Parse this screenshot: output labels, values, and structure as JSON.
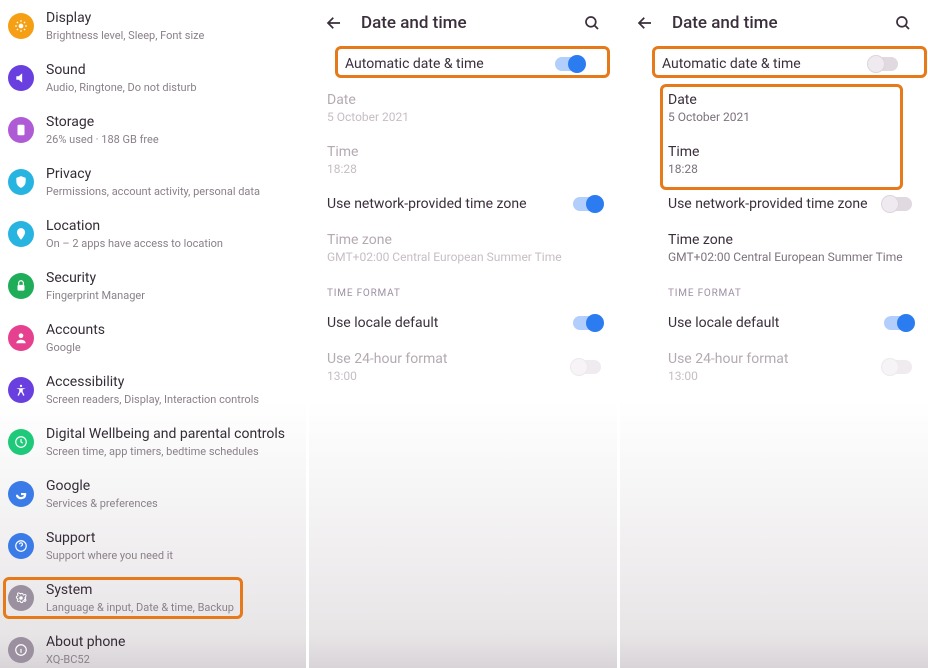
{
  "settings": {
    "items": [
      {
        "title": "Display",
        "sub": "Brightness level, Sleep, Font size",
        "color": "#f5a014"
      },
      {
        "title": "Sound",
        "sub": "Audio, Ringtone, Do not disturb",
        "color": "#6a3fe0"
      },
      {
        "title": "Storage",
        "sub": "26% used · 188 GB free",
        "color": "#b05bd6"
      },
      {
        "title": "Privacy",
        "sub": "Permissions, account activity, personal data",
        "color": "#28b4e0"
      },
      {
        "title": "Location",
        "sub": "On – 2 apps have access to location",
        "color": "#28b4e0"
      },
      {
        "title": "Security",
        "sub": "Fingerprint Manager",
        "color": "#1fad5a"
      },
      {
        "title": "Accounts",
        "sub": "Google",
        "color": "#e6418f"
      },
      {
        "title": "Accessibility",
        "sub": "Screen readers, Display, Interaction controls",
        "color": "#6a3fe0"
      },
      {
        "title": "Digital Wellbeing and parental controls",
        "sub": "Screen time, app timers, bedtime schedules",
        "color": "#1fc97a"
      },
      {
        "title": "Google",
        "sub": "Services & preferences",
        "color": "#3a7be8"
      },
      {
        "title": "Support",
        "sub": "Support where you need it",
        "color": "#3a7be8"
      },
      {
        "title": "System",
        "sub": "Language & input, Date & time, Backup",
        "color": "#9a90a0"
      },
      {
        "title": "About phone",
        "sub": "XQ-BC52",
        "color": "#9a90a0"
      }
    ]
  },
  "dt": {
    "title": "Date and time",
    "auto": "Automatic date & time",
    "date_l": "Date",
    "date_v": "5 October 2021",
    "time_l": "Time",
    "time_v": "18:28",
    "netzone": "Use network-provided time zone",
    "tz_l": "Time zone",
    "tz_v": "GMT+02:00 Central European Summer Time",
    "sect": "TIME FORMAT",
    "locale": "Use locale default",
    "h24_l": "Use 24-hour format",
    "h24_v": "13:00"
  }
}
